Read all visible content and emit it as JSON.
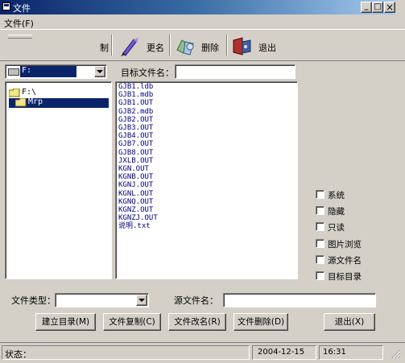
{
  "window": {
    "title": "文件",
    "menu_item": "文件(F)",
    "min_label": "_",
    "max_label": "□",
    "close_label": "×"
  },
  "toolbar": {
    "copy_label_partial": "制",
    "rename_label": "更名",
    "delete_label": "删除",
    "exit_label": "退出"
  },
  "drive_combo": {
    "value": "F:"
  },
  "target_name": {
    "label": "目标文件名：",
    "value": ""
  },
  "folders": [
    {
      "label": "F:\\",
      "selected": false
    },
    {
      "label": "Mrp",
      "selected": true
    }
  ],
  "files": [
    "GJB1.ldb",
    "GJB1.mdb",
    "GJB1.OUT",
    "GJB2.mdb",
    "GJB2.OUT",
    "GJB3.OUT",
    "GJB4.OUT",
    "GJB7.OUT",
    "GJB8.OUT",
    "JXLB.OUT",
    "KGN.OUT",
    "KGNB.OUT",
    "KGNJ.OUT",
    "KGNL.OUT",
    "KGNQ.OUT",
    "KGNZ.OUT",
    "KGNZJ.OUT",
    "说明.txt"
  ],
  "attributes": [
    {
      "label": "系统",
      "checked": false
    },
    {
      "label": "隐藏",
      "checked": false
    },
    {
      "label": "只读",
      "checked": false
    },
    {
      "label": "图片浏览",
      "checked": false
    },
    {
      "label": "源文件名",
      "checked": false
    },
    {
      "label": "目标目录",
      "checked": false
    }
  ],
  "file_type": {
    "label": "文件类型：",
    "value": ""
  },
  "source_name": {
    "label": "源文件名：",
    "value": ""
  },
  "buttons": {
    "mkdir": "建立目录(M)",
    "copy": "文件复制(C)",
    "rename": "文件改名(R)",
    "delete": "文件删除(D)",
    "exit": "退出(X)"
  },
  "status": {
    "label": "状态：",
    "date": "2004-12-15",
    "time": "16:31"
  },
  "colors": {
    "title_start": "#0a246a",
    "title_end": "#a6caf0",
    "selection": "#0a246a",
    "link_text": "#000080"
  }
}
